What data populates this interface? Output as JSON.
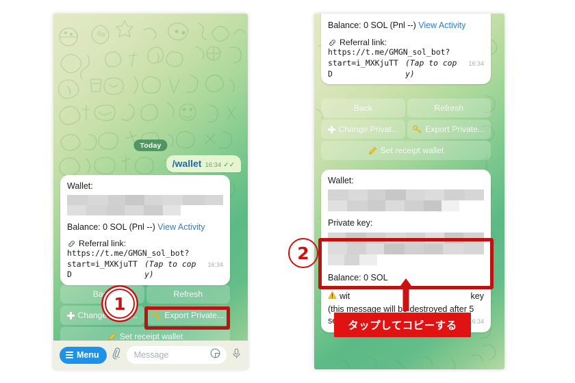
{
  "meta": {
    "accent_red": "#cc1111",
    "callout_red": "#e01212",
    "link_blue": "#2e7cc4",
    "menu_blue": "#1c93e8"
  },
  "left_phone": {
    "day_badge": "Today",
    "outgoing": {
      "text": "/wallet",
      "time": "16:34",
      "tick": "✓✓"
    },
    "card": {
      "wallet_label": "Wallet:",
      "balance": "Balance: 0 SOL (Pnl --)",
      "view_activity": "View Activity",
      "referral_label": "Referral link:",
      "referral_url_line1": "https://t.me/GMGN_sol_bot?",
      "referral_url_line2": "start=i_MXKjuTTD",
      "tap_to_copy": "(Tap to copy)",
      "time": "16:34",
      "link_icon": "link-icon"
    },
    "keyboard": {
      "back": "Back",
      "refresh": "Refresh",
      "change_private": "Change Privat...",
      "export_private": "Export Private...",
      "set_receipt_wallet": "Set receipt wallet",
      "plus_icon": "plus-icon",
      "key_icon": "key-icon",
      "pencil_icon": "pencil-icon"
    },
    "composer": {
      "menu": "Menu",
      "message_placeholder": "Message",
      "attach_icon": "paperclip-icon",
      "sticker_icon": "sticker-icon",
      "mic_icon": "microphone-icon"
    }
  },
  "right_phone": {
    "card_top": {
      "balance": "Balance: 0 SOL (Pnl --)",
      "view_activity": "View Activity",
      "referral_label": "Referral link:",
      "referral_url_line1": "https://t.me/GMGN_sol_bot?",
      "referral_url_line2": "start=i_MXKjuTTD",
      "tap_to_copy": "(Tap to copy)",
      "time": "16:34",
      "link_icon": "link-icon"
    },
    "keyboard": {
      "back": "Back",
      "refresh": "Refresh",
      "change_private": "Change Privat...",
      "export_private": "Export Private...",
      "set_receipt_wallet": "Set receipt wallet",
      "plus_icon": "plus-icon",
      "key_icon": "key-icon",
      "pencil_icon": "pencil-icon"
    },
    "card_bottom": {
      "wallet_label": "Wallet:",
      "private_key_label": "Private key:",
      "balance": "Balance: 0 SOL",
      "warning_icon": "warning-icon",
      "warning_line1_left": "wit",
      "warning_line1_right": "key",
      "destroy_note_line1": "(this message will be destroyed after 5",
      "destroy_note_line2": "seconds)",
      "time": "16:34"
    }
  },
  "annotations": {
    "marker_one": "①",
    "marker_one_value": "1",
    "marker_two": "②",
    "marker_two_value": "2",
    "callout_text": "タップしてコピーする",
    "arrow_icon": "up-arrow-icon"
  }
}
